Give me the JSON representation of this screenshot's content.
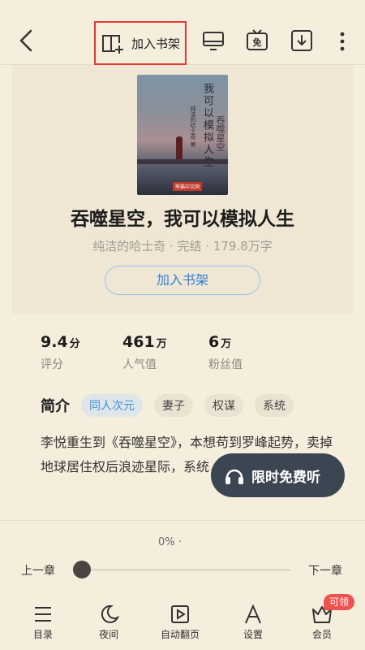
{
  "header": {
    "add_shelf_label": "加入书架"
  },
  "book": {
    "cover_title": "我可以模拟人生",
    "cover_subtitle": "吞噬星空",
    "cover_author": "纯洁的哈士奇 著",
    "cover_logo": "熊猫中文网",
    "title": "吞噬星空，我可以模拟人生",
    "meta": "纯洁的哈士奇 · 完结 · 179.8万字",
    "add_shelf_button": "加入书架"
  },
  "stats": [
    {
      "value": "9.4",
      "unit": "分",
      "label": "评分"
    },
    {
      "value": "461",
      "unit": "万",
      "label": "人气值"
    },
    {
      "value": "6",
      "unit": "万",
      "label": "粉丝值"
    }
  ],
  "intro": {
    "label": "简介",
    "tags": [
      "同人次元",
      "妻子",
      "权谋",
      "系统"
    ],
    "text": "李悦重生到《吞噬星空》，本想苟到罗峰起势，卖掉地球居住权后浪迹星际，系统，无限人生模拟器；"
  },
  "listen_button": "限时免费听",
  "reader": {
    "progress": "0% ·",
    "prev_chapter": "上一章",
    "next_chapter": "下一章",
    "progress_fraction": 0
  },
  "bottom_nav": {
    "items": [
      "目录",
      "夜间",
      "自动翻页",
      "设置",
      "会员"
    ],
    "badge": "可领"
  },
  "colors": {
    "background": "#f6eedd",
    "accent_blue": "#2f7fd6",
    "highlight_red": "#e53935",
    "listen_bg": "#3c4652"
  }
}
